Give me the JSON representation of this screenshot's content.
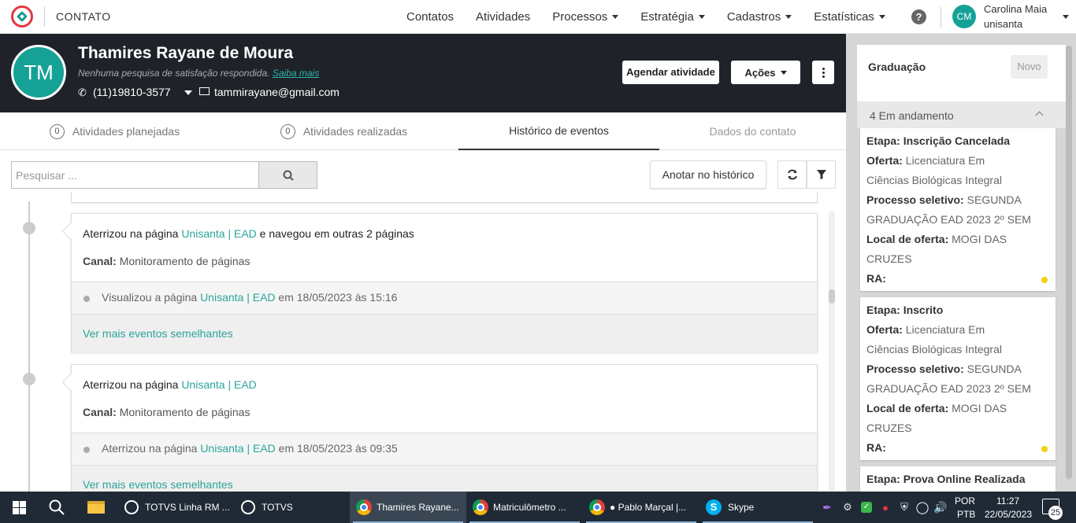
{
  "topnav": {
    "title": "CONTATO",
    "menu": [
      "Contatos",
      "Atividades",
      "Processos",
      "Estratégia",
      "Cadastros",
      "Estatísticas"
    ],
    "help": "?",
    "user": {
      "initials": "CM",
      "name": "Carolina Maia",
      "org": "unisanta"
    }
  },
  "contact": {
    "initials": "TM",
    "name": "Thamires Rayane de Moura",
    "survey_text": "Nenhuma pesquisa de satisfação respondida.",
    "survey_link": "Saiba mais",
    "phone": "(11)19810-3577",
    "email": "tammirayane@gmail.com",
    "schedule_button": "Agendar atividade",
    "actions_button": "Ações"
  },
  "tabs": [
    {
      "count": "0",
      "label": "Atividades planejadas"
    },
    {
      "count": "0",
      "label": "Atividades realizadas"
    },
    {
      "label": "Histórico de eventos"
    },
    {
      "label": "Dados do contato"
    }
  ],
  "search": {
    "placeholder": "Pesquisar ..."
  },
  "annotate_button": "Anotar no histórico",
  "events": [
    {
      "head_pre": "Aterrizou na página ",
      "head_link": "Unisanta | EAD",
      "head_post": " e navegou em outras 2 páginas",
      "channel_label": "Canal:",
      "channel_value": "Monitoramento de páginas",
      "sub_pre": "Visualizou a página ",
      "sub_link": "Unisanta | EAD",
      "sub_post": " em 18/05/2023 às 15:16",
      "more": "Ver mais eventos semelhantes"
    },
    {
      "head_pre": "Aterrizou na página ",
      "head_link": "Unisanta | EAD",
      "head_post": "",
      "channel_label": "Canal:",
      "channel_value": "Monitoramento de páginas",
      "sub_pre": "Aterrizou na página ",
      "sub_link": "Unisanta | EAD",
      "sub_post": " em 18/05/2023 às 09:35",
      "more": "Ver mais eventos semelhantes"
    }
  ],
  "right_panel": {
    "title": "Graduação",
    "new_button": "Novo",
    "group_label": "4 Em andamento",
    "cards": [
      {
        "etapa_label": "Etapa:",
        "etapa": "Inscrição Cancelada",
        "oferta_label": "Oferta:",
        "oferta_1": "Licenciatura Em",
        "oferta_2": "Ciências Biológicas Integral",
        "processo_label": "Processo seletivo:",
        "processo_1": "SEGUNDA",
        "processo_2": "GRADUAÇÃO EAD 2023 2º SEM",
        "local_label": "Local de oferta:",
        "local_1": "MOGI DAS",
        "local_2": "CRUZES",
        "ra_label": "RA:"
      },
      {
        "etapa_label": "Etapa:",
        "etapa": "Inscrito",
        "oferta_label": "Oferta:",
        "oferta_1": "Licenciatura Em",
        "oferta_2": "Ciências Biológicas Integral",
        "processo_label": "Processo seletivo:",
        "processo_1": "SEGUNDA",
        "processo_2": "GRADUAÇÃO EAD 2023 2º SEM",
        "local_label": "Local de oferta:",
        "local_1": "MOGI DAS",
        "local_2": "CRUZES",
        "ra_label": "RA:"
      },
      {
        "etapa_label": "Etapa:",
        "etapa": "Prova Online Realizada"
      }
    ]
  },
  "taskbar": {
    "apps": [
      "TOTVS Linha RM ...",
      "TOTVS",
      "Thamires Rayane...",
      "Matriculômetro ...",
      "● Pablo Marçal |...",
      "Skype"
    ],
    "lang_1": "POR",
    "lang_2": "PTB",
    "time": "11:27",
    "date": "22/05/2023",
    "notifications": "25"
  },
  "colors": {
    "teal": "#16a197",
    "header_dark": "#1f2329",
    "link": "#2aa49a",
    "status_yellow": "#f2d20a"
  }
}
